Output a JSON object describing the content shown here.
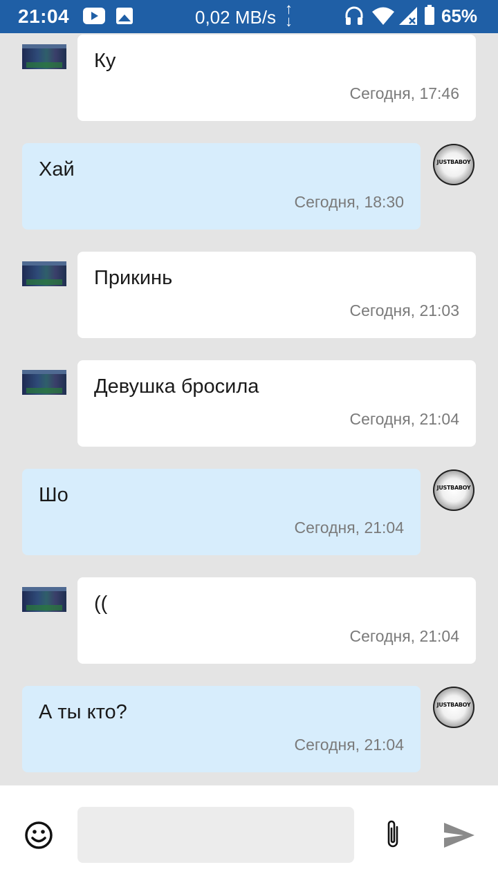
{
  "status_bar": {
    "time": "21:04",
    "net_speed": "0,02 MB/s",
    "arrow_up": "↑",
    "arrow_down": "↓",
    "battery": "65%",
    "icons": [
      "youtube-icon",
      "image-icon",
      "headphones-icon",
      "wifi-icon",
      "signal-icon",
      "battery-icon"
    ]
  },
  "messages": [
    {
      "direction": "in",
      "text": "Ку",
      "time": "Сегодня, 17:46"
    },
    {
      "direction": "out",
      "text": "Хай",
      "time": "Сегодня, 18:30"
    },
    {
      "direction": "in",
      "text": "Прикинь",
      "time": "Сегодня, 21:03"
    },
    {
      "direction": "in",
      "text": "Девушка бросила",
      "time": "Сегодня, 21:04"
    },
    {
      "direction": "out",
      "text": "Шо",
      "time": "Сегодня, 21:04"
    },
    {
      "direction": "in",
      "text": "((",
      "time": "Сегодня, 21:04"
    },
    {
      "direction": "out",
      "text": "А ты кто?",
      "time": "Сегодня, 21:04"
    }
  ],
  "avatar_out_text": "JUSTBABOY",
  "input": {
    "value": "",
    "placeholder": "",
    "icons": [
      "emoji-icon",
      "paperclip-icon",
      "send-icon"
    ]
  },
  "colors": {
    "status_bar": "#1f5fa6",
    "background": "#e4e4e4",
    "incoming_bubble": "#ffffff",
    "outgoing_bubble": "#d7edfc",
    "timestamp": "#7a7a7a"
  }
}
